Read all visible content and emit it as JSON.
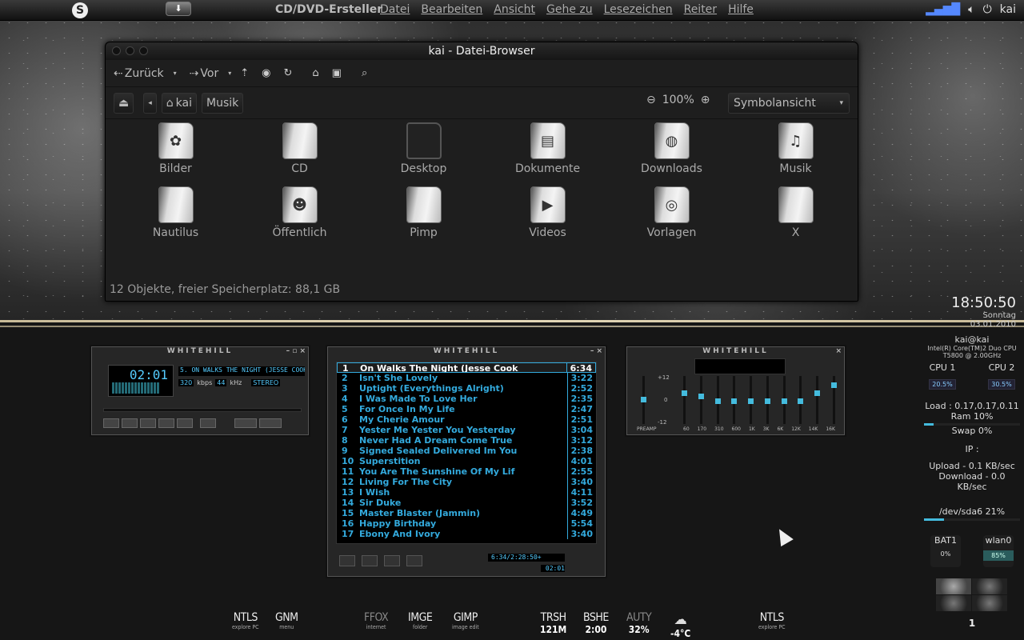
{
  "panel": {
    "app_name": "CD/DVD-Ersteller",
    "menu": [
      "Datei",
      "Bearbeiten",
      "Ansicht",
      "Gehe zu",
      "Lesezeichen",
      "Reiter",
      "Hilfe"
    ],
    "user": "kai",
    "update_icon": "download-icon"
  },
  "browser": {
    "title": "kai - Datei-Browser",
    "toolbar": {
      "back": "Zurück",
      "forward": "Vor"
    },
    "path": [
      "kai",
      "Musik"
    ],
    "zoom": "100%",
    "view": "Symbolansicht",
    "items": [
      {
        "label": "Bilder",
        "icon": "pictures-folder-icon",
        "glyph": "✿"
      },
      {
        "label": "CD",
        "icon": "cd-folder-icon",
        "glyph": ""
      },
      {
        "label": "Desktop",
        "icon": "desktop-folder-icon",
        "glyph": ""
      },
      {
        "label": "Dokumente",
        "icon": "documents-folder-icon",
        "glyph": "▤"
      },
      {
        "label": "Downloads",
        "icon": "downloads-folder-icon",
        "glyph": "◍"
      },
      {
        "label": "Musik",
        "icon": "music-folder-icon",
        "glyph": "♫"
      },
      {
        "label": "Nautilus",
        "icon": "folder-icon",
        "glyph": ""
      },
      {
        "label": "Öffentlich",
        "icon": "public-folder-icon",
        "glyph": "☻"
      },
      {
        "label": "Pimp",
        "icon": "folder-icon",
        "glyph": ""
      },
      {
        "label": "Videos",
        "icon": "videos-folder-icon",
        "glyph": "▶"
      },
      {
        "label": "Vorlagen",
        "icon": "templates-folder-icon",
        "glyph": "◎"
      },
      {
        "label": "X",
        "icon": "folder-icon",
        "glyph": ""
      }
    ],
    "status": "12 Objekte, freier Speicherplatz: 88,1 GB"
  },
  "clock": {
    "time": "18:50:50",
    "date": "Sonntag 03.01.2010"
  },
  "winamp": {
    "skin": "WHITEHILL",
    "time": "02:01",
    "ticker": "5. ON WALKS THE NIGHT (JESSE COOK",
    "kbps": "320",
    "khz": "44",
    "kbps_label": "kbps",
    "khz_label": "kHz",
    "stereo": "STEREO",
    "playlist": [
      {
        "n": "1",
        "title": "On Walks The Night (Jesse Cook",
        "dur": "6:34"
      },
      {
        "n": "2",
        "title": "Isn't She Lovely",
        "dur": "3:22"
      },
      {
        "n": "3",
        "title": "Uptight (Everythings Alright)",
        "dur": "2:52"
      },
      {
        "n": "4",
        "title": "I Was Made To Love Her",
        "dur": "2:35"
      },
      {
        "n": "5",
        "title": "For Once In My Life",
        "dur": "2:47"
      },
      {
        "n": "6",
        "title": "My Cherie Amour",
        "dur": "2:51"
      },
      {
        "n": "7",
        "title": "Yester Me Yester You Yesterday",
        "dur": "3:04"
      },
      {
        "n": "8",
        "title": "Never Had A Dream Come True",
        "dur": "3:12"
      },
      {
        "n": "9",
        "title": "Signed Sealed Delivered Im You",
        "dur": "2:38"
      },
      {
        "n": "10",
        "title": "Superstition",
        "dur": "4:01"
      },
      {
        "n": "11",
        "title": "You Are The Sunshine Of My Lif",
        "dur": "2:55"
      },
      {
        "n": "12",
        "title": "Living For The City",
        "dur": "3:40"
      },
      {
        "n": "13",
        "title": "I Wish",
        "dur": "4:11"
      },
      {
        "n": "14",
        "title": "Sir Duke",
        "dur": "3:52"
      },
      {
        "n": "15",
        "title": "Master Blaster (Jammin)",
        "dur": "4:49"
      },
      {
        "n": "16",
        "title": "Happy Birthday",
        "dur": "5:54"
      },
      {
        "n": "17",
        "title": "Ebony And Ivory",
        "dur": "3:40"
      }
    ],
    "pl_total": "6:34/2:28:50+",
    "pl_time": "02:01",
    "eq": {
      "db": [
        "+12",
        "0",
        "-12"
      ],
      "bands": [
        "60",
        "170",
        "310",
        "600",
        "1K",
        "3K",
        "6K",
        "12K",
        "14K",
        "16K"
      ],
      "preamp": "PREAMP"
    }
  },
  "conky": {
    "host": "kai@kai",
    "cpu_model": "Intel(R) Core(TM)2 Duo CPU",
    "cpu_speed": "T5800  @ 2.00GHz",
    "cpu1_label": "CPU 1",
    "cpu1": "20.5%",
    "cpu2_label": "CPU 2",
    "cpu2": "30.5%",
    "load": "Load : 0.17,0.17,0.11",
    "ram": "Ram 10%",
    "swap": "Swap 0%",
    "ip": "IP :",
    "upload": "Upload - 0.1 KB/sec",
    "download": "Download - 0.0 KB/sec",
    "disk": "/dev/sda6 21%",
    "bat_label": "BAT1",
    "bat": "0%",
    "wlan_label": "wlan0",
    "wlan": "85%",
    "workspace": "1"
  },
  "dock": [
    {
      "a": "NTLS",
      "b": "explore PC"
    },
    {
      "a": "GNM",
      "b": "menu"
    },
    {
      "a": "FFOX",
      "b": "internet",
      "dim": true
    },
    {
      "a": "IMGE",
      "b": "folder"
    },
    {
      "a": "GIMP",
      "b": "image edit"
    },
    {
      "a": "TRSH",
      "b": "",
      "v": "121M"
    },
    {
      "a": "BSHE",
      "b": "",
      "v": "2:00"
    },
    {
      "a": "AUTY",
      "b": "",
      "v": "32%",
      "dim": true
    },
    {
      "a": "",
      "b": "",
      "v": "-4°C",
      "weather": true
    },
    {
      "a": "NTLS",
      "b": "explore PC"
    }
  ]
}
